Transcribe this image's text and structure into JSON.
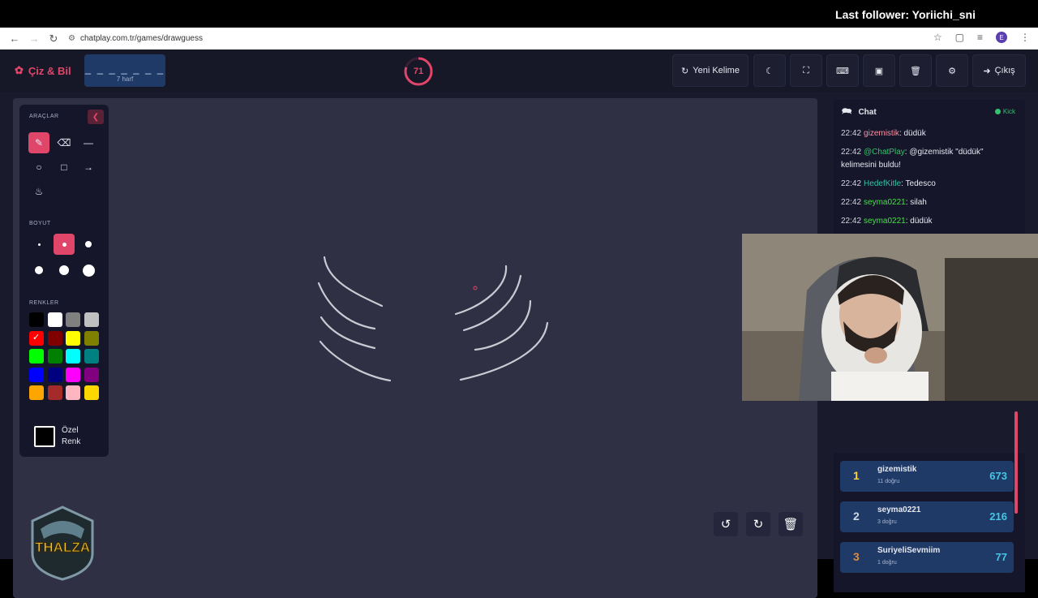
{
  "overlay": {
    "follower_text": "Last follower: Yoriichi_sni"
  },
  "browser": {
    "url": "chatplay.com.tr/games/drawguess",
    "profile_initial": "E"
  },
  "header": {
    "logo": "Çiz & Bil",
    "word_mask": "_ _ _ _ _ _ _",
    "word_length": "7 harf",
    "timer": "71",
    "timer_fraction": 0.8,
    "new_word": "Yeni Kelime",
    "exit": "Çıkış"
  },
  "toolbar": {
    "tools_label": "ARAÇLAR",
    "size_label": "BOYUT",
    "colors_label": "RENKLER",
    "custom_line1": "Özel",
    "custom_line2": "Renk",
    "colors": [
      "#000000",
      "#ffffff",
      "#808080",
      "#c0c0c0",
      "#ff0000",
      "#800000",
      "#ffff00",
      "#808000",
      "#00ff00",
      "#008000",
      "#00ffff",
      "#008080",
      "#0000ff",
      "#000080",
      "#ff00ff",
      "#800080",
      "#ffa500",
      "#a52a2a",
      "#ffb6c1",
      "#ffd700"
    ],
    "selected_color": "#ff0000",
    "selected_size": 2
  },
  "chat": {
    "title": "Chat",
    "platform": "Kick",
    "messages": [
      {
        "time": "22:42",
        "user": "gizemistik",
        "color": "#ff8fa3",
        "text": ": düdük"
      },
      {
        "time": "22:42",
        "user": "@ChatPlay",
        "color": "#34c26a",
        "text": ": @gizemistik \"düdük\" kelimesini buldu!"
      },
      {
        "time": "22:42",
        "user": "HedefKitle",
        "color": "#34c2a6",
        "text": ": Tedesco"
      },
      {
        "time": "22:42",
        "user": "seyma0221",
        "color": "#46e046",
        "text": ": silah"
      },
      {
        "time": "22:42",
        "user": "seyma0221",
        "color": "#46e046",
        "text": ": düdük"
      }
    ]
  },
  "leaderboard": [
    {
      "rank": "1",
      "name": "gizemistik",
      "correct": "11 doğru",
      "score": "673",
      "rank_color": "#ffd23f"
    },
    {
      "rank": "2",
      "name": "seyma0221",
      "correct": "3 doğru",
      "score": "216",
      "rank_color": "#cfd6e4"
    },
    {
      "rank": "3",
      "name": "SuriyeliSevmiim",
      "correct": "1 doğru",
      "score": "77",
      "rank_color": "#e08a3c"
    }
  ],
  "channel_logo_text": "THALZA"
}
